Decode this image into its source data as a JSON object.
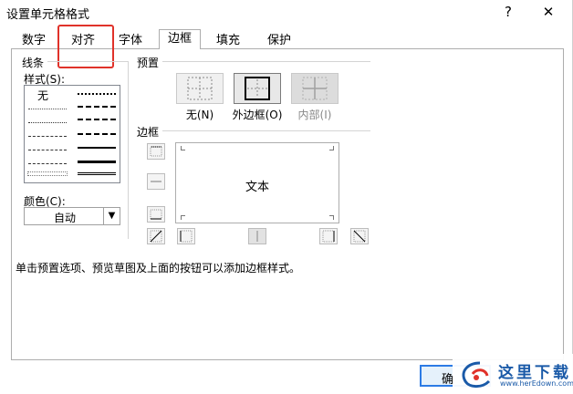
{
  "window": {
    "title": "设置单元格格式",
    "help_label": "?",
    "close_label": "✕"
  },
  "tabs": [
    {
      "label": "数字",
      "active": false
    },
    {
      "label": "对齐",
      "active": false
    },
    {
      "label": "字体",
      "active": false
    },
    {
      "label": "边框",
      "active": true
    },
    {
      "label": "填充",
      "active": false
    },
    {
      "label": "保护",
      "active": false
    }
  ],
  "line_group": {
    "title": "线条",
    "style_label": "样式(S):",
    "none_label": "无",
    "color_label": "颜色(C):",
    "color_value": "自动"
  },
  "presets": {
    "title": "预置",
    "items": [
      {
        "label": "无(N)",
        "state": "normal"
      },
      {
        "label": "外边框(O)",
        "state": "selected"
      },
      {
        "label": "内部(I)",
        "state": "disabled"
      }
    ]
  },
  "border_group": {
    "title": "边框",
    "preview_text": "文本"
  },
  "hint_text": "单击预置选项、预览草图及上面的按钮可以添加边框样式。",
  "ok_button": {
    "label": "确"
  },
  "watermark": {
    "text": "这里下载",
    "url": "www.herEdown.com"
  },
  "colors": {
    "highlight": "#e0322a",
    "accent": "#2c7be5",
    "watermark": "#1a5aa8"
  }
}
